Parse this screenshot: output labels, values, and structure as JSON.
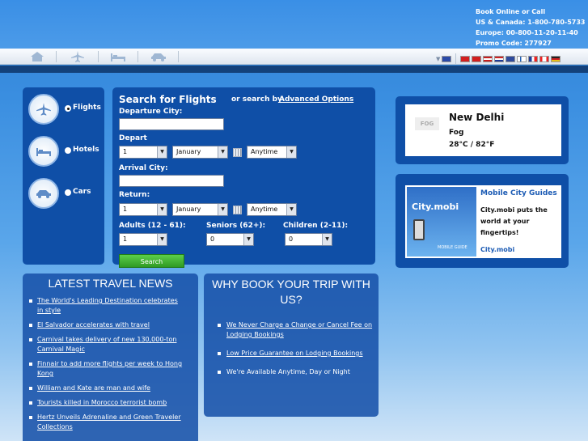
{
  "contact": {
    "line1": "Book Online or Call",
    "line2": "US & Canada: 1-800-780-5733",
    "line3": "Europe: 00-800-11-20-11-40",
    "line4": "Promo Code: 277927"
  },
  "nav": {
    "icons": [
      "home-icon",
      "plane-icon",
      "bed-icon",
      "car-icon"
    ]
  },
  "flags": [
    "#2a4aa8",
    "#d21f1f",
    "#d21f1f",
    "#c81e1e",
    "#1f3c99",
    "#d21f1f",
    "#2e4a9c",
    "#e7e7ee",
    "#1d5fb5",
    "#e22",
    "#d4b51a"
  ],
  "tabs": [
    {
      "label": "Flights"
    },
    {
      "label": "Hotels"
    },
    {
      "label": "Cars"
    }
  ],
  "search": {
    "title": "Search for Flights",
    "or_text": "or search by",
    "advanced": "Advanced Options",
    "departure_label": "Departure City:",
    "depart_label": "Depart",
    "depart_day": "1",
    "depart_month": "January",
    "depart_time": "Anytime",
    "arrival_label": "Arrival City:",
    "return_label": "Return:",
    "return_day": "1",
    "return_month": "January",
    "return_time": "Anytime",
    "adults_label": "Adults (12 - 61):",
    "adults": "1",
    "seniors_label": "Seniors (62+):",
    "seniors": "0",
    "children_label": "Children (2-11):",
    "children": "0",
    "button": "Search"
  },
  "weather": {
    "city": "New Delhi",
    "condition": "Fog",
    "temp": "28°C / 82°F",
    "icon_text": "FOG"
  },
  "mobile": {
    "title": "Mobile City Guides",
    "text1": "City.mobi puts the",
    "text2": "world at your",
    "text3": "fingertips!",
    "link": "City.mobi",
    "logo": "City.mobi",
    "caption": "MOBILE GUIDE"
  },
  "news": {
    "title": "LATEST TRAVEL NEWS",
    "items": [
      "The World's Leading Destination celebrates in style",
      "El Salvador accelerates with  travel",
      "Carnival takes delivery of new 130,000-ton Carnival Magic",
      "Finnair to add more flights per week to Hong Kong",
      "William and Kate are man and wife",
      "Tourists killed in Morocco terrorist bomb",
      "Hertz Unveils Adrenaline and Green Traveler Collections"
    ]
  },
  "why": {
    "title": "WHY BOOK YOUR TRIP WITH US?",
    "items": [
      "We Never Charge a Change or Cancel Fee on Lodging Bookings",
      "Low Price Guarantee on Lodging Bookings",
      "We're Available Anytime, Day or Night"
    ]
  }
}
